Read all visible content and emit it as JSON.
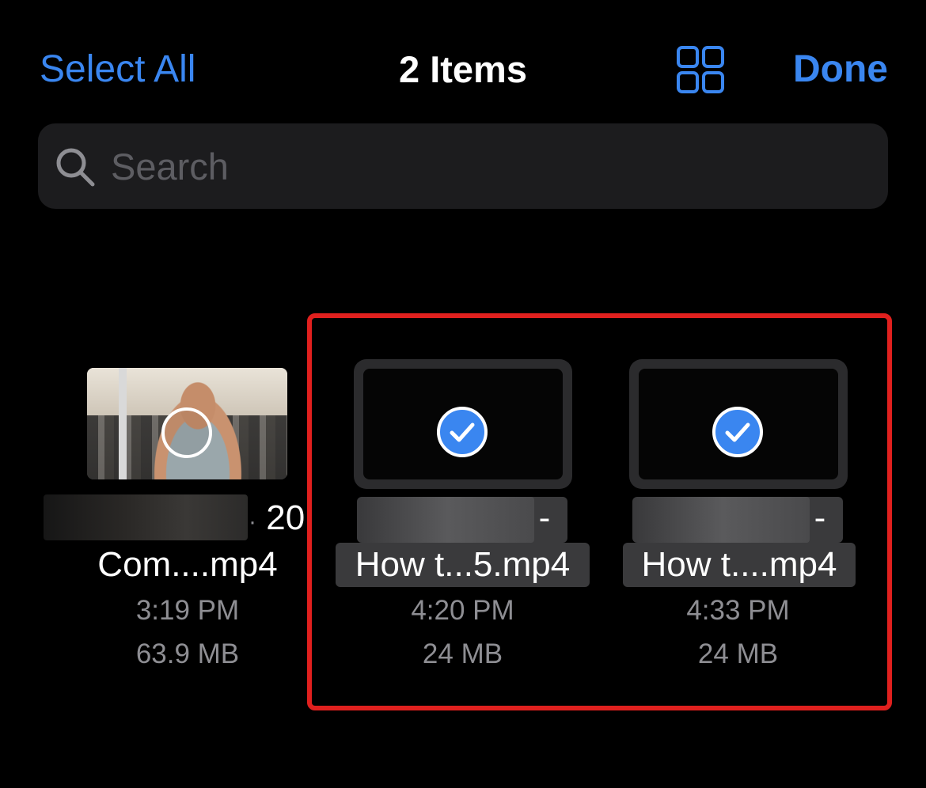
{
  "header": {
    "select_all_label": "Select All",
    "title": "2 Items",
    "grid_icon": "grid-icon",
    "done_label": "Done"
  },
  "search": {
    "placeholder": "Search",
    "icon": "search-icon"
  },
  "colors": {
    "accent": "#3a86f0",
    "highlight": "#e0201e",
    "background": "#000000"
  },
  "files": [
    {
      "name_suffix_line": "20",
      "name": "Com....mp4",
      "time": "3:19 PM",
      "size": "63.9 MB",
      "selected": false
    },
    {
      "name_suffix_line": "-",
      "name": "How t...5.mp4",
      "time": "4:20 PM",
      "size": "24 MB",
      "selected": true
    },
    {
      "name_suffix_line": "-",
      "name": "How t....mp4",
      "time": "4:33 PM",
      "size": "24 MB",
      "selected": true
    }
  ]
}
